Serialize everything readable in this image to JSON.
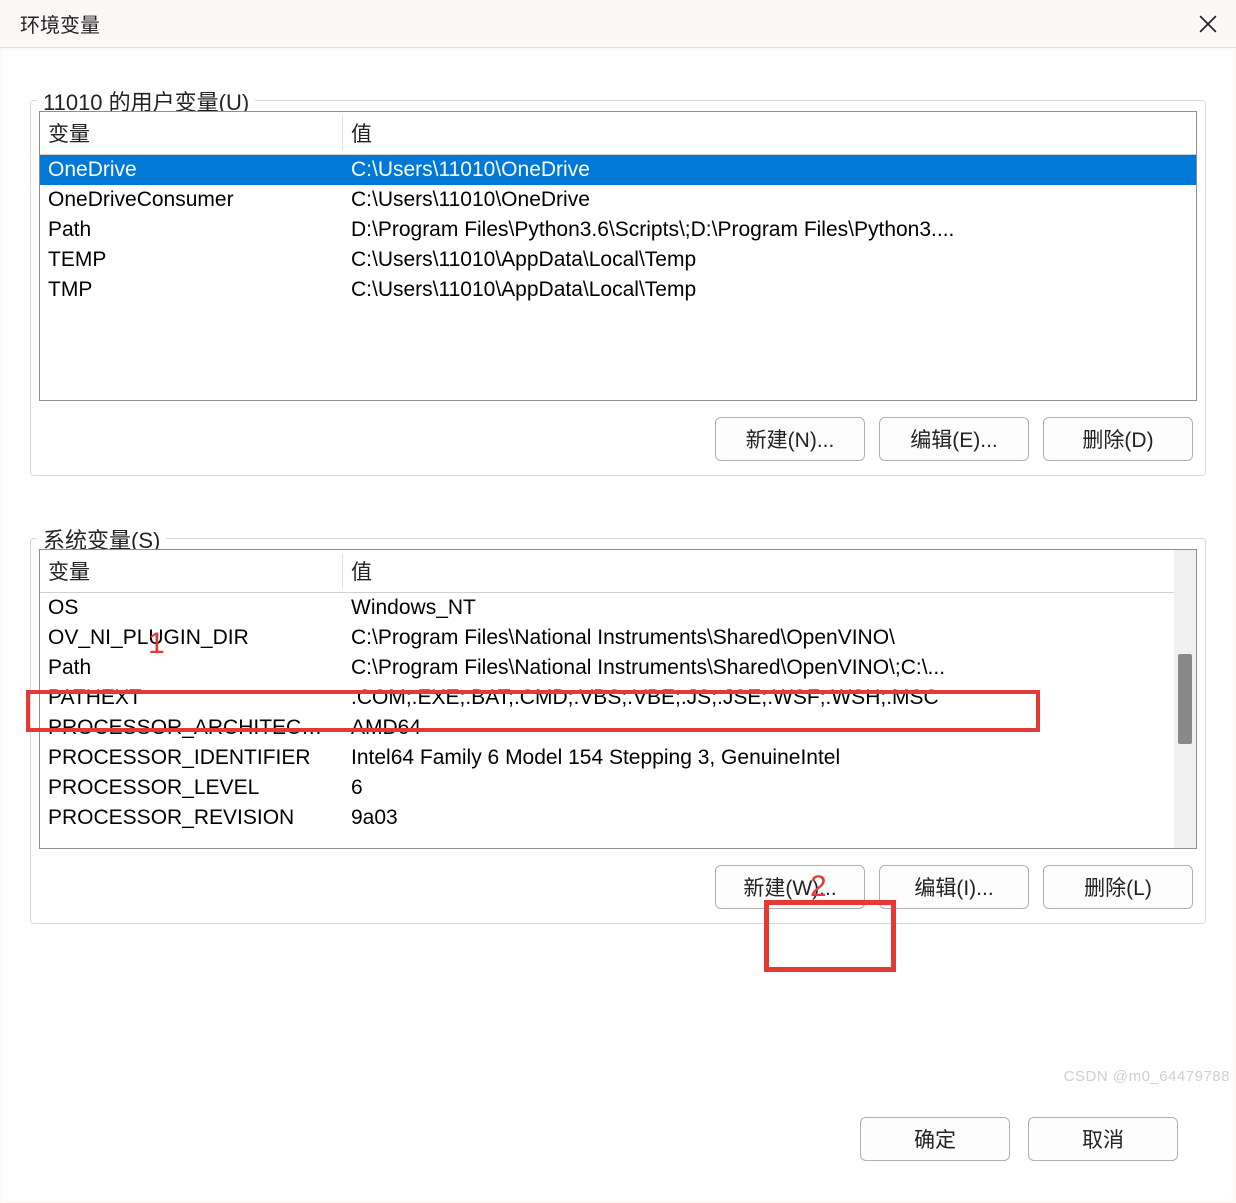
{
  "window": {
    "title": "环境变量"
  },
  "userVars": {
    "groupLabel": "11010 的用户变量(U)",
    "columns": {
      "variable": "变量",
      "value": "值"
    },
    "rows": [
      {
        "variable": "OneDrive",
        "value": "C:\\Users\\11010\\OneDrive",
        "selected": true
      },
      {
        "variable": "OneDriveConsumer",
        "value": "C:\\Users\\11010\\OneDrive",
        "selected": false
      },
      {
        "variable": "Path",
        "value": "D:\\Program Files\\Python3.6\\Scripts\\;D:\\Program Files\\Python3....",
        "selected": false
      },
      {
        "variable": "TEMP",
        "value": "C:\\Users\\11010\\AppData\\Local\\Temp",
        "selected": false
      },
      {
        "variable": "TMP",
        "value": "C:\\Users\\11010\\AppData\\Local\\Temp",
        "selected": false
      }
    ],
    "buttons": {
      "new": "新建(N)...",
      "edit": "编辑(E)...",
      "delete": "删除(D)"
    }
  },
  "sysVars": {
    "groupLabel": "系统变量(S)",
    "columns": {
      "variable": "变量",
      "value": "值"
    },
    "rows": [
      {
        "variable": "OS",
        "value": "Windows_NT"
      },
      {
        "variable": "OV_NI_PLUGIN_DIR",
        "value": "C:\\Program Files\\National Instruments\\Shared\\OpenVINO\\"
      },
      {
        "variable": "Path",
        "value": "C:\\Program Files\\National Instruments\\Shared\\OpenVINO\\;C:\\..."
      },
      {
        "variable": "PATHEXT",
        "value": ".COM;.EXE;.BAT;.CMD;.VBS;.VBE;.JS;.JSE;.WSF;.WSH;.MSC"
      },
      {
        "variable": "PROCESSOR_ARCHITECTU...",
        "value": "AMD64"
      },
      {
        "variable": "PROCESSOR_IDENTIFIER",
        "value": "Intel64 Family 6 Model 154 Stepping 3, GenuineIntel"
      },
      {
        "variable": "PROCESSOR_LEVEL",
        "value": "6"
      },
      {
        "variable": "PROCESSOR_REVISION",
        "value": "9a03"
      }
    ],
    "buttons": {
      "new": "新建(W)...",
      "edit": "编辑(I)...",
      "delete": "删除(L)"
    }
  },
  "dialog": {
    "ok": "确定",
    "cancel": "取消"
  },
  "annotations": {
    "label1": "1",
    "label2": "2"
  },
  "watermark": "CSDN @m0_64479788"
}
